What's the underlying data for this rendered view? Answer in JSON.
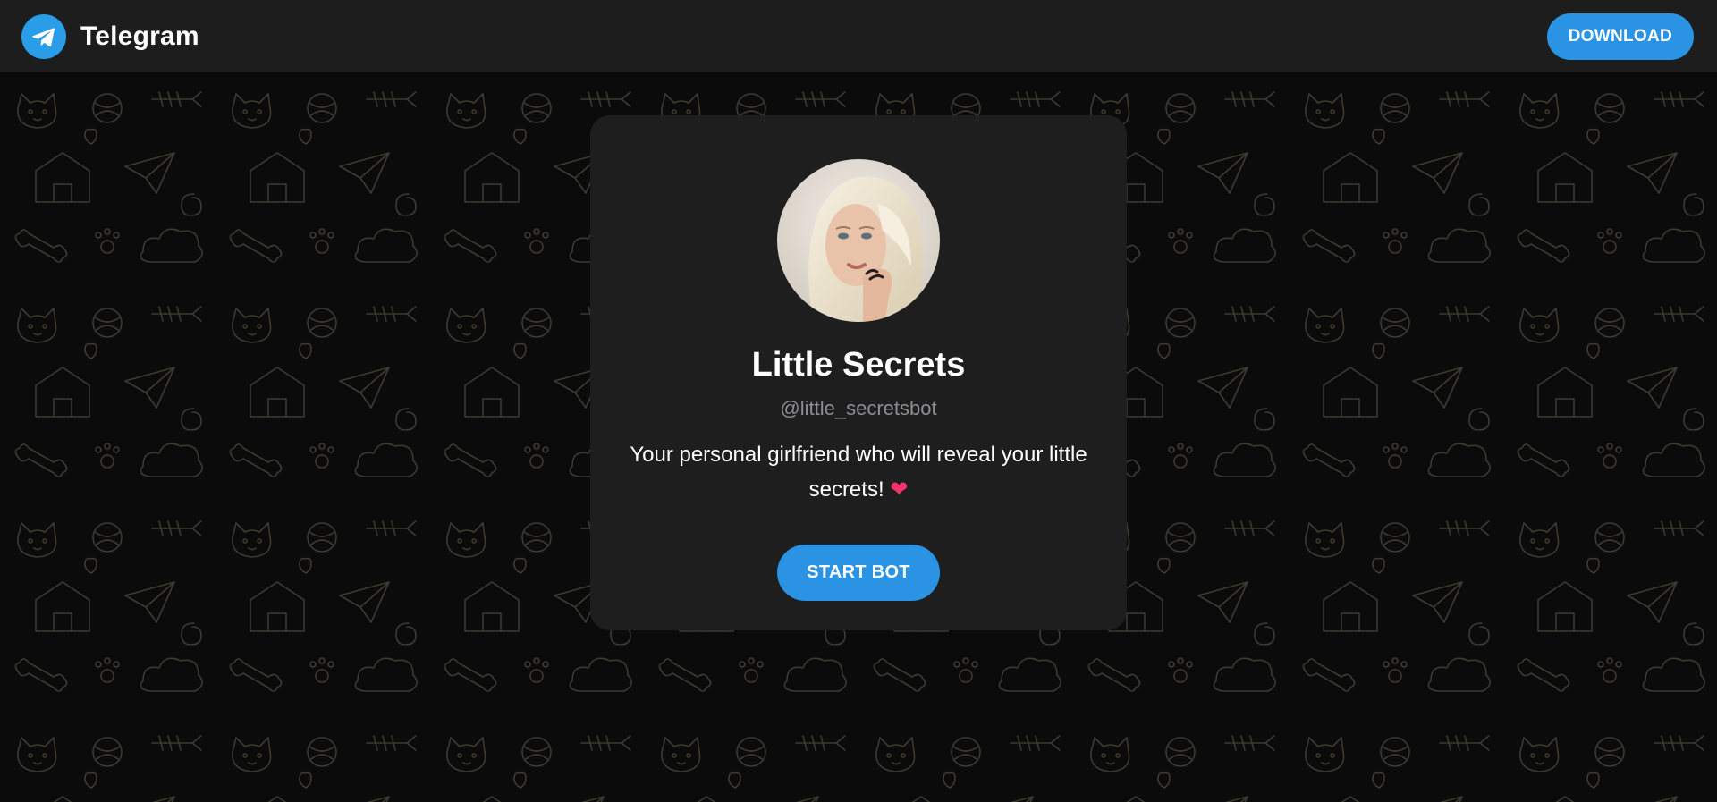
{
  "header": {
    "brand_name": "Telegram",
    "logo_icon": "telegram-paper-plane-icon",
    "download_label": "DOWNLOAD"
  },
  "profile": {
    "title": "Little Secrets",
    "username": "@little_secretsbot",
    "description": "Your personal girlfriend who will reveal your little secrets!",
    "description_emoji": "❤",
    "start_label": "START BOT"
  },
  "colors": {
    "accent": "#2a93e3",
    "header_bg": "#1d1d1e",
    "card_bg": "#1e1e1f",
    "page_bg": "#0b0b0b",
    "muted_text": "#8e8e93",
    "heart": "#f5336b"
  }
}
